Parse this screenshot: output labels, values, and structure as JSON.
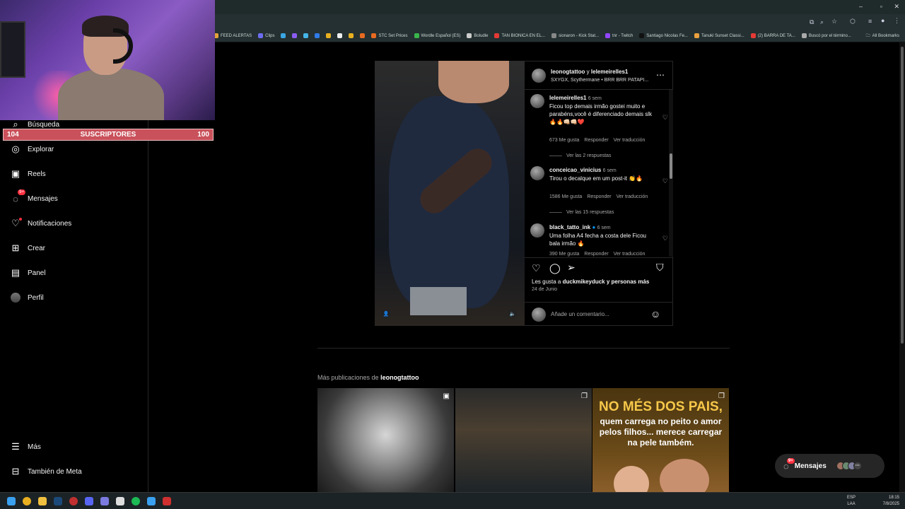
{
  "browser": {
    "bookmarks": [
      {
        "label": "FEED ALERTAS",
        "color": "#e3a33a"
      },
      {
        "label": "Clips",
        "color": "#6c6cf0"
      },
      {
        "label": "",
        "color": "#3aa6e3"
      },
      {
        "label": "",
        "color": "#8a5cf0"
      },
      {
        "label": "",
        "color": "#45b5e8"
      },
      {
        "label": "",
        "color": "#2f7be8"
      },
      {
        "label": "",
        "color": "#e8b020"
      },
      {
        "label": "",
        "color": "#eee"
      },
      {
        "label": "",
        "color": "#e8b020"
      },
      {
        "label": "",
        "color": "#e86a20"
      },
      {
        "label": "STC Set Prices",
        "color": "#e86a20"
      },
      {
        "label": "Wordle Español (ES)",
        "color": "#3ab54a"
      },
      {
        "label": "Boludle",
        "color": "#cccccc"
      },
      {
        "label": "TAN BIONICA EN EL...",
        "color": "#e53935"
      },
      {
        "label": "sionaron - Kick Stat...",
        "color": "#888888"
      },
      {
        "label": "tnr - Twitch",
        "color": "#9146ff"
      },
      {
        "label": "Santiago Nicolas Fe...",
        "color": "#111111"
      },
      {
        "label": "Tanuki Sunset Classi...",
        "color": "#e8a040"
      },
      {
        "label": "(2) BARRA DE TA...",
        "color": "#e53935"
      },
      {
        "label": "Buscó por el término...",
        "color": "#aaaaaa"
      }
    ],
    "all_bookmarks": "All Bookmarks"
  },
  "overlay": {
    "sub_left": "104",
    "sub_center": "SUSCRIPTORES",
    "sub_right": "100"
  },
  "sidebar": {
    "items": [
      {
        "label": "Búsqueda",
        "icon": "search-icon"
      },
      {
        "label": "Explorar",
        "icon": "compass-icon"
      },
      {
        "label": "Reels",
        "icon": "reels-icon"
      },
      {
        "label": "Mensajes",
        "icon": "messenger-icon",
        "badge": "9+"
      },
      {
        "label": "Notificaciones",
        "icon": "heart-icon"
      },
      {
        "label": "Crear",
        "icon": "plus-square-icon"
      },
      {
        "label": "Panel",
        "icon": "chart-icon"
      },
      {
        "label": "Perfil",
        "icon": "profile-avatar"
      }
    ],
    "more": "Más",
    "meta": "También de Meta"
  },
  "post": {
    "author": "leonogtattoo",
    "connector": " y ",
    "coauthor": "lelemeirelles1",
    "audio": "SXYGX, Scythermane • BRR BRR PATAPI...",
    "likes_prefix": "Les gusta a ",
    "likes_user": "duckmikeyduck",
    "likes_suffix": " y personas más",
    "date": "24 de Junio",
    "comment_placeholder": "Añade un comentario...",
    "comments": [
      {
        "user": "lelemeirelles1",
        "time": "6 sem",
        "text": "Ficou top demais irmão gostei muito e parabéns,você é diferenciado demais slk 🔥🔥👊🏻👊🏻❤️",
        "likes": "673 Me gusta",
        "reply": "Responder",
        "translate": "Ver traducción",
        "replies": "Ver las 2 respuestas"
      },
      {
        "user": "conceicao_vinicius",
        "time": "6 sem",
        "text": "Tirou o decalque em um post-it 👏🔥",
        "likes": "1586 Me gusta",
        "reply": "Responder",
        "translate": "Ver traducción",
        "replies": "Ver las 15 respuestas"
      },
      {
        "user": "black_tatto_ink",
        "time": "6 sem",
        "text": "Uma folha A4 fecha a costa dele Ficou bala irmão 🔥",
        "likes": "390 Me gusta",
        "reply": "Responder",
        "translate": "Ver traducción"
      }
    ]
  },
  "more_posts": {
    "prefix": "Más publicaciones de ",
    "user": "leonogtattoo",
    "thumb3_headline": "NO MÉS DOS PAIS,",
    "thumb3_sub": "quem carrega no peito o amor pelos filhos... merece carregar na pele também."
  },
  "messages_pill": {
    "label": "Mensajes",
    "badge": "9+"
  },
  "taskbar": {
    "lang1": "ESP",
    "lang2": "LAA",
    "time": "18:15",
    "date": "7/8/2025"
  }
}
